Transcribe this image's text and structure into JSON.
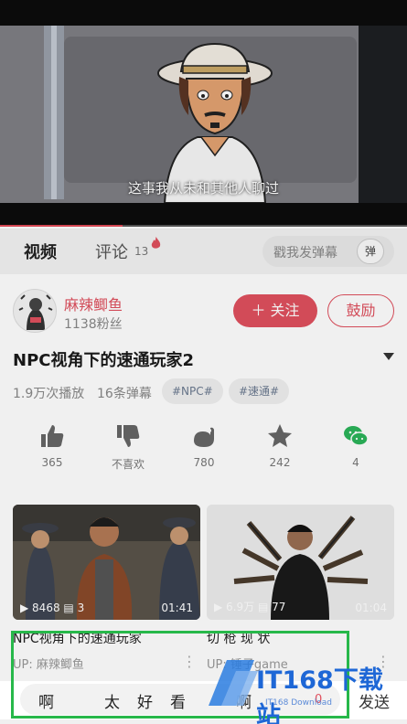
{
  "player": {
    "subtitle": "这事我从未和其他人聊过",
    "progress": 0.3
  },
  "tabs": {
    "video_label": "视频",
    "comment_label": "评论",
    "comment_count": "13",
    "danmu_placeholder": "戳我发弹幕",
    "danmu_toggle": "弹"
  },
  "uploader": {
    "name": "麻辣鲫鱼",
    "fans": "1138粉丝",
    "follow_label": "关注",
    "charge_label": "鼓励"
  },
  "video": {
    "title": "NPC视角下的速通玩家2",
    "plays": "1.9万次播放",
    "danmu_count": "16条弹幕",
    "tags": [
      "#NPC#",
      "#速通#"
    ]
  },
  "actions": [
    {
      "icon": "thumbs-up-icon",
      "label": "365"
    },
    {
      "icon": "thumbs-down-icon",
      "label": "不喜欢"
    },
    {
      "icon": "coin-icon",
      "label": "780"
    },
    {
      "icon": "star-icon",
      "label": "242"
    },
    {
      "icon": "wechat-icon",
      "label": "4"
    }
  ],
  "related": [
    {
      "plays": "8468",
      "comments": "3",
      "duration": "01:41",
      "title": "NPC视角下的速通玩家",
      "up": "UP: 麻辣鲫鱼"
    },
    {
      "plays": "6.9万",
      "comments": "77",
      "duration": "01:04",
      "title": "切 枪 现 状",
      "up": "UP: 锤子game"
    }
  ],
  "input": {
    "text": "啊　　　太　好　看　　　啊",
    "count": "0",
    "send_label": "发送"
  },
  "watermark": {
    "logo": "IT168下载站",
    "sub": "IT168 Download"
  },
  "colors": {
    "accent": "#e0505e",
    "frame": "#27b84a",
    "wechat": "#2bb45a"
  }
}
